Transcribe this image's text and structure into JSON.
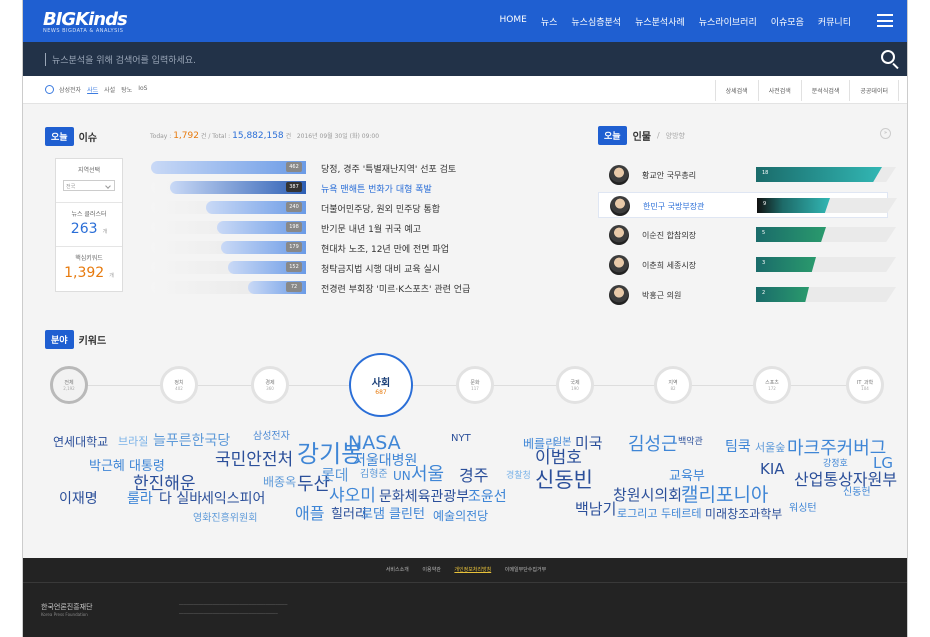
{
  "header": {
    "logo": "BIGKinds",
    "logo_sub": "NEWS BIGDATA & ANALYSIS",
    "nav": [
      "HOME",
      "뉴스",
      "뉴스심층분석",
      "뉴스분석사례",
      "뉴스라이브러리",
      "이슈모음",
      "커뮤니티"
    ]
  },
  "search": {
    "placeholder": "뉴스분석을 위해 검색어를 입력하세요."
  },
  "subbar": {
    "history": [
      "삼성전자",
      "사드",
      "사설",
      "탕노",
      "IoS"
    ],
    "tools": [
      "상세검색",
      "사전검색",
      "분석식검색",
      "공공데이터"
    ]
  },
  "issues": {
    "pill": "오늘",
    "word": "이슈",
    "today_label": "Today :",
    "today_value": "1,792",
    "total_label": "건 / Total :",
    "total_value": "15,882,158",
    "total_unit": "건",
    "date": "2016년 09월 30일 (화) 09:00",
    "region_label": "지역선택",
    "region_value": "전국",
    "cluster_label": "뉴스 클러스터",
    "cluster_value": "263",
    "cluster_unit": "개",
    "keyword_label": "핵심키워드",
    "keyword_value": "1,392",
    "keyword_unit": "개",
    "items": [
      {
        "count": "462",
        "count_n": 462,
        "title": "당정, 경주 '특별재난지역' 선포 검토"
      },
      {
        "count": "387",
        "count_n": 387,
        "title": "뉴욕 맨해튼 번화가 대형 폭발"
      },
      {
        "count": "240",
        "count_n": 240,
        "title": "더불어민주당, 원외 민주당 통합"
      },
      {
        "count": "198",
        "count_n": 198,
        "title": "반기문 내년 1월 귀국 예고"
      },
      {
        "count": "179",
        "count_n": 179,
        "title": "현대차 노조, 12년 만에 전면 파업"
      },
      {
        "count": "152",
        "count_n": 152,
        "title": "청탁금지법 시행 대비 교육 실시"
      },
      {
        "count": "72",
        "count_n": 72,
        "title": "전경련 부회장 '미르·K스포츠' 관련 언급"
      }
    ]
  },
  "people": {
    "pill": "오늘",
    "word": "인물",
    "inactive_tab": "양방향",
    "items": [
      {
        "name": "황교안 국무총리",
        "score": "18",
        "level": 0.9
      },
      {
        "name": "한민구 국방부장관",
        "score": "9",
        "level": 0.52
      },
      {
        "name": "이순진 합참의장",
        "score": "5",
        "level": 0.5
      },
      {
        "name": "이춘희 세종시장",
        "score": "3",
        "level": 0.43
      },
      {
        "name": "박홍근 의원",
        "score": "2",
        "level": 0.38
      }
    ]
  },
  "keywords": {
    "pill": "분야",
    "word": "키워드",
    "categories": [
      {
        "name": "전체",
        "count": "2,192"
      },
      {
        "name": "정치",
        "count": "402"
      },
      {
        "name": "경제",
        "count": "360"
      },
      {
        "name": "사회",
        "count": "687"
      },
      {
        "name": "문화",
        "count": "117"
      },
      {
        "name": "국제",
        "count": "190"
      },
      {
        "name": "지역",
        "count": "82"
      },
      {
        "name": "스포츠",
        "count": "172"
      },
      {
        "name": "IT_과학",
        "count": "104"
      }
    ],
    "cloud": [
      "연세대학교",
      "브라질",
      "늘푸른한국당",
      "국민안전처",
      "강기봉",
      "삼성전자",
      "NASA",
      "서울대병원",
      "NYT",
      "베를린",
      "일본",
      "미국",
      "김성근",
      "백악관",
      "팀쿡",
      "서울숲",
      "마크주커버그",
      "박근혜 대통령",
      "이범호",
      "KIA",
      "강정호",
      "LG",
      "한진해운",
      "배종옥",
      "두산",
      "롯데",
      "김형준",
      "UN",
      "서울",
      "경주",
      "경찰청",
      "신동빈",
      "교육부",
      "산업통상자원부",
      "이재명",
      "룰라",
      "다 실바",
      "세익스피어",
      "샤오미",
      "문화체육관광부",
      "조윤선",
      "창원시의회",
      "캘리포니아",
      "신동헌",
      "영화진흥위원회",
      "애플",
      "힐러리",
      "로댐 클린턴",
      "예술의전당",
      "백남기",
      "로그리고 두테르테",
      "미래창조과학부",
      "워싱턴"
    ]
  },
  "footer": {
    "links": [
      "서비스소개",
      "이용약관",
      "개인정보처리방침",
      "이메일무단수집거부"
    ],
    "org": "한국언론진흥재단",
    "org_sub": "Korea Press Foundation"
  }
}
